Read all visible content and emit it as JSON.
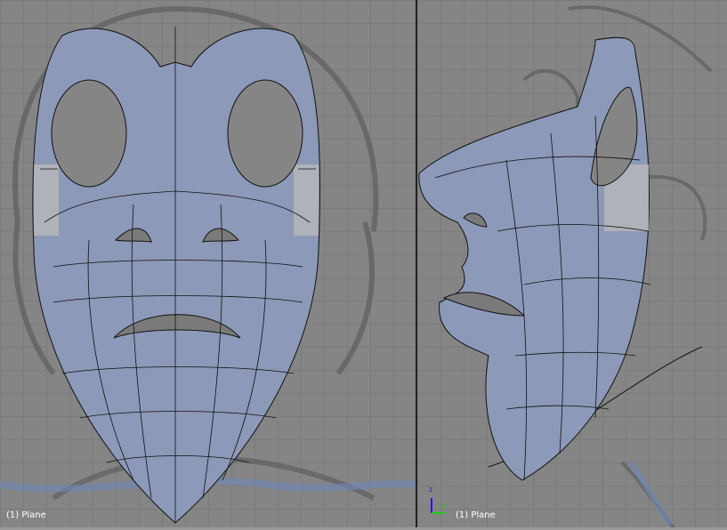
{
  "viewports": [
    {
      "name": "front",
      "object_label": "(1) Plane"
    },
    {
      "name": "side",
      "object_label": "(1) Plane",
      "axis_labels": {
        "up": "z",
        "right": "y"
      }
    }
  ],
  "colors": {
    "mesh_fill": "#8c99b8",
    "background": "#858585",
    "wire": "#111111",
    "axis_z": "#1a1aff",
    "axis_y": "#22cc22"
  }
}
